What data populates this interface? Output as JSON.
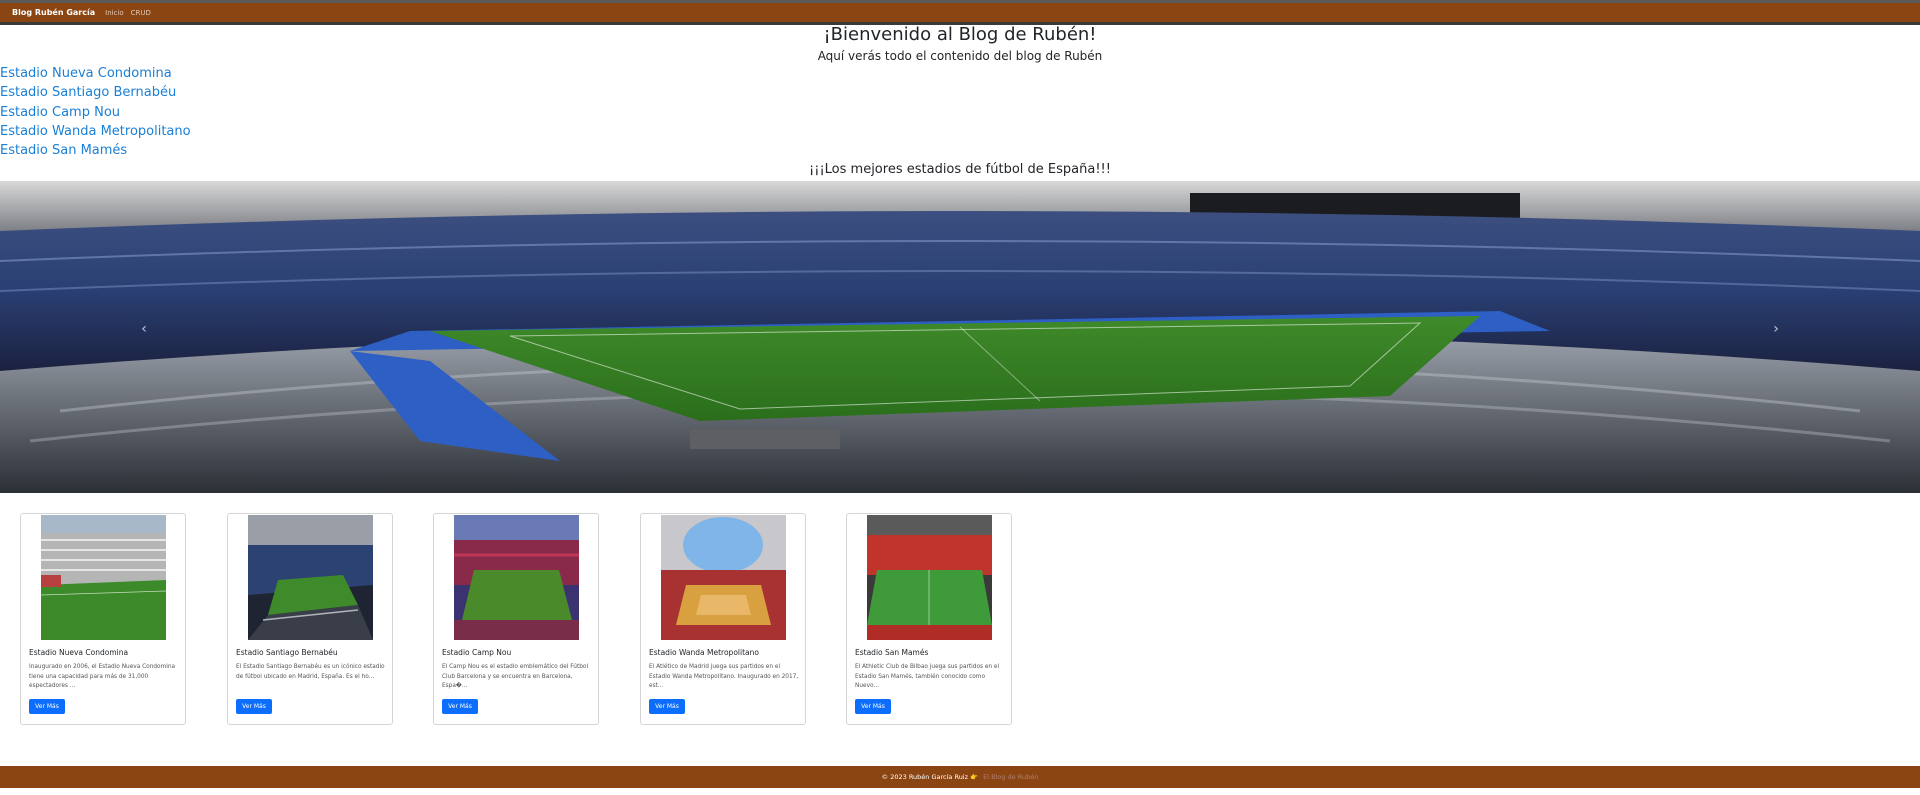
{
  "navbar": {
    "brand": "Blog Rubén García",
    "links": [
      "Inicio",
      "CRUD"
    ]
  },
  "header": {
    "title": "¡Bienvenido al Blog de Rubén!",
    "subtitle": "Aquí verás todo el contenido del blog de Rubén"
  },
  "stadium_links": [
    "Estadio Nueva Condomina",
    "Estadio Santiago Bernabéu",
    "Estadio Camp Nou",
    "Estadio Wanda Metropolitano",
    "Estadio San Mamés"
  ],
  "section_title": "¡¡¡Los mejores estadios de fútbol de España!!!",
  "carousel": {
    "prev_icon": "chevron-left-icon",
    "next_icon": "chevron-right-icon",
    "prev_glyph": "‹",
    "next_glyph": "›"
  },
  "cards": [
    {
      "title": "Estadio Nueva Condomina",
      "text": "Inaugurado en 2006, el Estadio Nueva Condomina tiene una capacidad para más de 31,000 espectadores ...",
      "button": "Ver Más"
    },
    {
      "title": "Estadio Santiago Bernabéu",
      "text": "El Estadio Santiago Bernabéu es un icónico estadio de fútbol ubicado en Madrid, España. Es el ho...",
      "button": "Ver Más"
    },
    {
      "title": "Estadio Camp Nou",
      "text": "El Camp Nou es el estadio emblemático del Fútbol Club Barcelona y se encuentra en Barcelona, Espa�...",
      "button": "Ver Más"
    },
    {
      "title": "Estadio Wanda Metropolitano",
      "text": "El Atlético de Madrid juega sus partidos en el Estadio Wanda Metropolitano. Inaugurado en 2017, est...",
      "button": "Ver Más"
    },
    {
      "title": "Estadio San Mamés",
      "text": "El Athletic Club de Bilbao juega sus partidos en el Estadio San Mamés, también conocido como Nuevo...",
      "button": "Ver Más"
    }
  ],
  "footer": {
    "text": "© 2023 Rubén García Ruiz",
    "hand_glyph": "👉",
    "link": "El Blog de Rubén"
  },
  "colors": {
    "navbar_bg": "#8b4513",
    "link_blue": "#1a7fd6",
    "button_blue": "#0d6efd",
    "footer_bg": "#8b4513"
  }
}
